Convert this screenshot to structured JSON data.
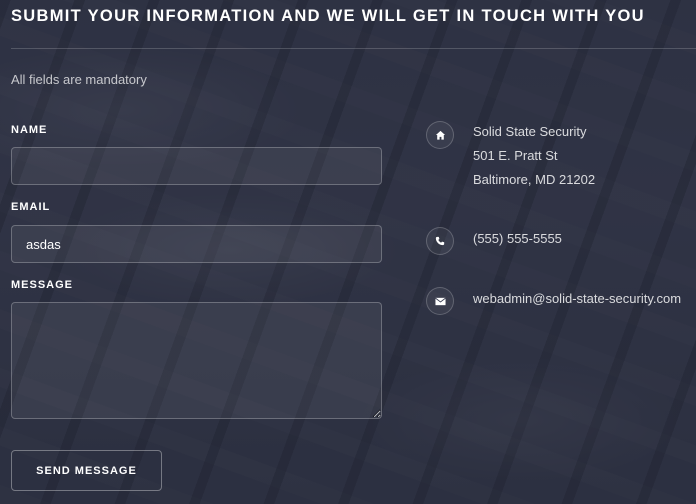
{
  "form": {
    "title": "SUBMIT YOUR INFORMATION AND WE WILL GET IN TOUCH WITH YOU",
    "mandatory_note": "All fields are mandatory",
    "name": {
      "label": "NAME",
      "value": "",
      "placeholder": ""
    },
    "email": {
      "label": "EMAIL",
      "value": "asdas",
      "placeholder": ""
    },
    "message": {
      "label": "MESSAGE",
      "value": "",
      "placeholder": ""
    },
    "send_label": "SEND MESSAGE"
  },
  "contact": {
    "address": {
      "icon": "home-icon",
      "lines": [
        "Solid State Security",
        "501 E. Pratt St",
        "Baltimore, MD 21202"
      ]
    },
    "phone": {
      "icon": "phone-icon",
      "value": "(555) 555-5555"
    },
    "email": {
      "icon": "envelope-icon",
      "value": "webadmin@solid-state-security.com"
    }
  },
  "colors": {
    "background": "#2d3142",
    "text": "#ffffff",
    "border": "#6b6e7d"
  }
}
